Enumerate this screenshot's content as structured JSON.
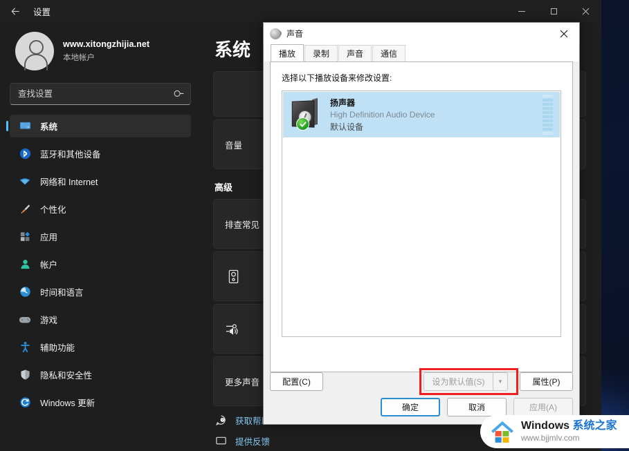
{
  "desktop": {
    "background_color": "#0a1226"
  },
  "settings_window": {
    "titlebar": {
      "back_icon": "back-arrow-icon",
      "title": "设置",
      "minimize_label": "—",
      "maximize_label": "□",
      "close_label": "✕"
    },
    "account": {
      "avatar_icon": "user-avatar-icon",
      "name": "www.xitongzhijia.net",
      "type": "本地帐户"
    },
    "search": {
      "placeholder": "查找设置",
      "value": "",
      "icon": "search-icon"
    },
    "nav_items": [
      {
        "label": "系统",
        "icon": "monitor-icon",
        "active": true
      },
      {
        "label": "蓝牙和其他设备",
        "icon": "bluetooth-icon",
        "active": false
      },
      {
        "label": "网络和 Internet",
        "icon": "wifi-icon",
        "active": false
      },
      {
        "label": "个性化",
        "icon": "paintbrush-icon",
        "active": false
      },
      {
        "label": "应用",
        "icon": "apps-icon",
        "active": false
      },
      {
        "label": "帐户",
        "icon": "account-icon",
        "active": false
      },
      {
        "label": "时间和语言",
        "icon": "clock-icon",
        "active": false
      },
      {
        "label": "游戏",
        "icon": "gamepad-icon",
        "active": false
      },
      {
        "label": "辅助功能",
        "icon": "accessibility-icon",
        "active": false
      },
      {
        "label": "隐私和安全性",
        "icon": "shield-icon",
        "active": false
      },
      {
        "label": "Windows 更新",
        "icon": "update-icon",
        "active": false
      }
    ],
    "content": {
      "page_title": "系统",
      "cards": [
        {
          "label": "",
          "icon": ""
        },
        {
          "label": "音量",
          "icon": ""
        }
      ],
      "section_label": "高级",
      "advanced_cards": [
        {
          "label": "排查常见",
          "icon": ""
        },
        {
          "label": "",
          "icon": "speaker-box-icon"
        },
        {
          "label": "",
          "icon": "volume-mixer-icon"
        },
        {
          "label": "更多声音",
          "icon": ""
        }
      ],
      "footer_links": [
        {
          "label": "获取帮助",
          "icon": "help-icon"
        },
        {
          "label": "提供反馈",
          "icon": "feedback-icon"
        }
      ]
    }
  },
  "sound_dialog": {
    "titlebar": {
      "icon": "sound-speaker-icon",
      "title": "声音",
      "close_label": "✕"
    },
    "tabs": [
      {
        "label": "播放",
        "active": true
      },
      {
        "label": "录制",
        "active": false
      },
      {
        "label": "声音",
        "active": false
      },
      {
        "label": "通信",
        "active": false
      }
    ],
    "list_prompt": "选择以下播放设备来修改设置:",
    "devices": [
      {
        "icon": "speaker-device-icon",
        "badge_icon": "green-check-icon",
        "name": "扬声器",
        "description": "High Definition Audio Device",
        "status": "默认设备",
        "meter_icon": "volume-meter-icon",
        "meter_bars": 10,
        "selected": true
      }
    ],
    "buttons": {
      "configure": {
        "label": "配置(C)",
        "disabled": false
      },
      "set_default": {
        "label": "设为默认值(S)",
        "disabled": true,
        "highlighted": true
      },
      "set_default_arrow": {
        "label": "▼",
        "icon": "chevron-down-icon"
      },
      "properties": {
        "label": "属性(P)",
        "disabled": false
      },
      "ok": {
        "label": "确定",
        "focused": true
      },
      "cancel": {
        "label": "取消",
        "disabled": false
      },
      "apply": {
        "label": "应用(A)",
        "disabled": true
      }
    },
    "highlight_color": "#f01e1e"
  },
  "watermark": {
    "logo_icon": "windows-house-logo-icon",
    "brand_en": "Windows ",
    "brand_cn": "系统之家",
    "url": "www.bjjmlv.com"
  }
}
